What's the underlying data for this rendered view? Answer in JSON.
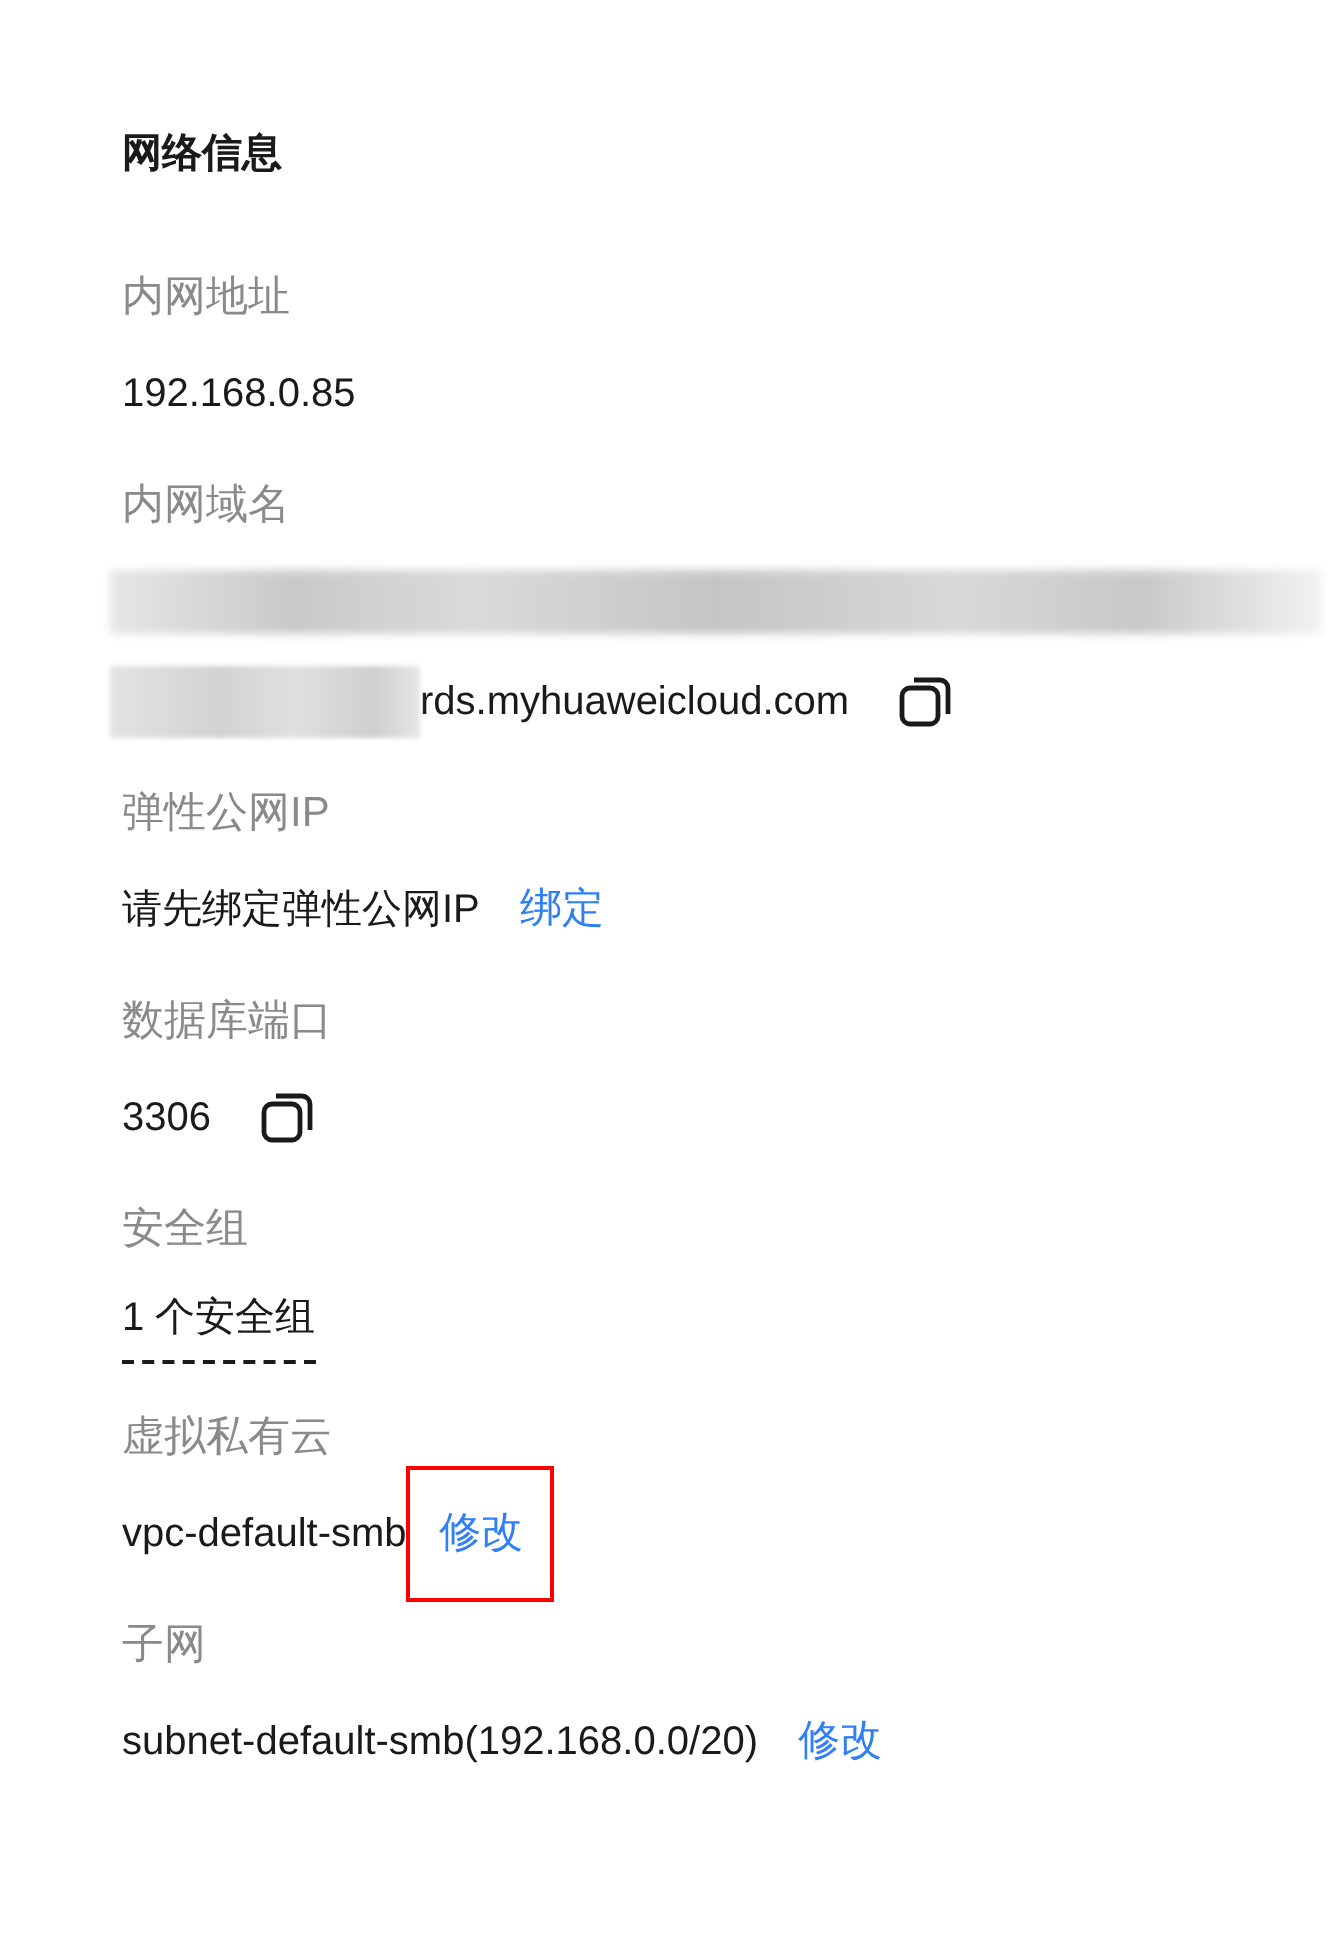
{
  "section": {
    "title": "网络信息"
  },
  "fields": [
    {
      "label": "内网地址",
      "lines": [
        [
          {
            "kind": "text",
            "text": "192.168.0.85"
          }
        ]
      ]
    },
    {
      "label": "内网域名",
      "lines": [
        [
          {
            "kind": "blur"
          }
        ],
        [
          {
            "kind": "blur_prefix"
          },
          {
            "kind": "text",
            "text": "rds.myhuaweicloud.com"
          },
          {
            "kind": "copy"
          }
        ]
      ]
    },
    {
      "label": "弹性公网IP",
      "lines": [
        [
          {
            "kind": "text",
            "text": "请先绑定弹性公网IP"
          },
          {
            "kind": "link",
            "text": "绑定",
            "highlighted": false
          }
        ]
      ]
    },
    {
      "label": "数据库端口",
      "lines": [
        [
          {
            "kind": "text",
            "text": "3306"
          },
          {
            "kind": "copy"
          }
        ]
      ]
    },
    {
      "label": "安全组",
      "lines": [
        [
          {
            "kind": "dashed",
            "text": "1 个安全组"
          }
        ]
      ]
    },
    {
      "label": "虚拟私有云",
      "lines": [
        [
          {
            "kind": "text",
            "text": "vpc-default-smb"
          },
          {
            "kind": "link",
            "text": "修改",
            "highlighted": true
          }
        ]
      ]
    },
    {
      "label": "子网",
      "lines": [
        [
          {
            "kind": "text",
            "text": "subnet-default-smb(192.168.0.0/20)"
          },
          {
            "kind": "link",
            "text": "修改",
            "highlighted": false
          }
        ]
      ]
    }
  ]
}
